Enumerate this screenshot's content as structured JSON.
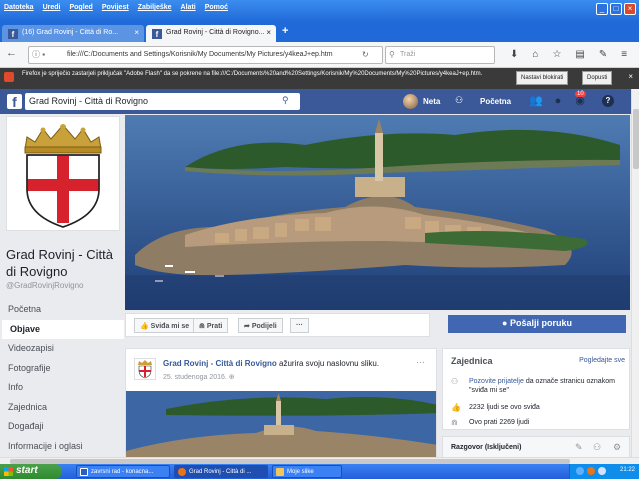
{
  "browser": {
    "menu": [
      "Datoteka",
      "Uredi",
      "Pogled",
      "Povijest",
      "Zabilješke",
      "Alati",
      "Pomoć"
    ],
    "tabs": [
      {
        "label": "(16) Grad Rovinj - Città di Ro..."
      },
      {
        "label": "Grad Rovinj - Città di Rovigno..."
      }
    ],
    "url": "file:///C:/Documents and Settings/Korisnik/My Documents/My Pictures/y4keaJ+ep.htm",
    "search_placeholder": "Traži",
    "notice": {
      "message": "Firefox je spriječio zastarjeli priključak \"Adobe Flash\" da se pokrene na file:///C:/Documents%20and%20Settings/Korisnik/My%20Documents/My%20Pictures/y4keaJ+ep.htm.",
      "continue_label": "Nastavi blokirati",
      "allow_label": "Dopusti"
    }
  },
  "facebook": {
    "search_value": "Grad Rovinj - Città di Rovigno",
    "user_name": "Neta",
    "home_label": "Početna",
    "notification_count": "10"
  },
  "page": {
    "name": "Grad Rovinj - Città di Rovigno",
    "handle": "@GradRovinjRovigno",
    "nav": [
      "Početna",
      "Objave",
      "Videozapisi",
      "Fotografije",
      "Info",
      "Zajednica",
      "Događaji",
      "Informacije i oglasi"
    ],
    "actions": {
      "like": "Sviđa mi se",
      "follow": "Prati",
      "share": "Podijeli",
      "more": "···"
    },
    "send_message": "Pošalji poruku"
  },
  "post": {
    "author": "Grad Rovinj - Città di Rovigno",
    "action": " ažurira svoju naslovnu sliku.",
    "date": "25. studenoga 2016."
  },
  "community": {
    "title": "Zajednica",
    "see_all": "Pogledajte sve",
    "invite_link": "Pozovite prijatelje",
    "invite_rest": " da označe stranicu oznakom \"sviđa mi se\"",
    "likes": "2232 ljudi se ovo sviđa",
    "follows": "Ovo prati 2269 ljudi"
  },
  "chat": {
    "label": "Razgovor (Isključeni)"
  },
  "taskbar": {
    "start": "start",
    "tasks": [
      "zavrsni rad - konacna...",
      "Grad Rovinj - Città di ...",
      "Moje slike"
    ],
    "clock": "21:22"
  }
}
